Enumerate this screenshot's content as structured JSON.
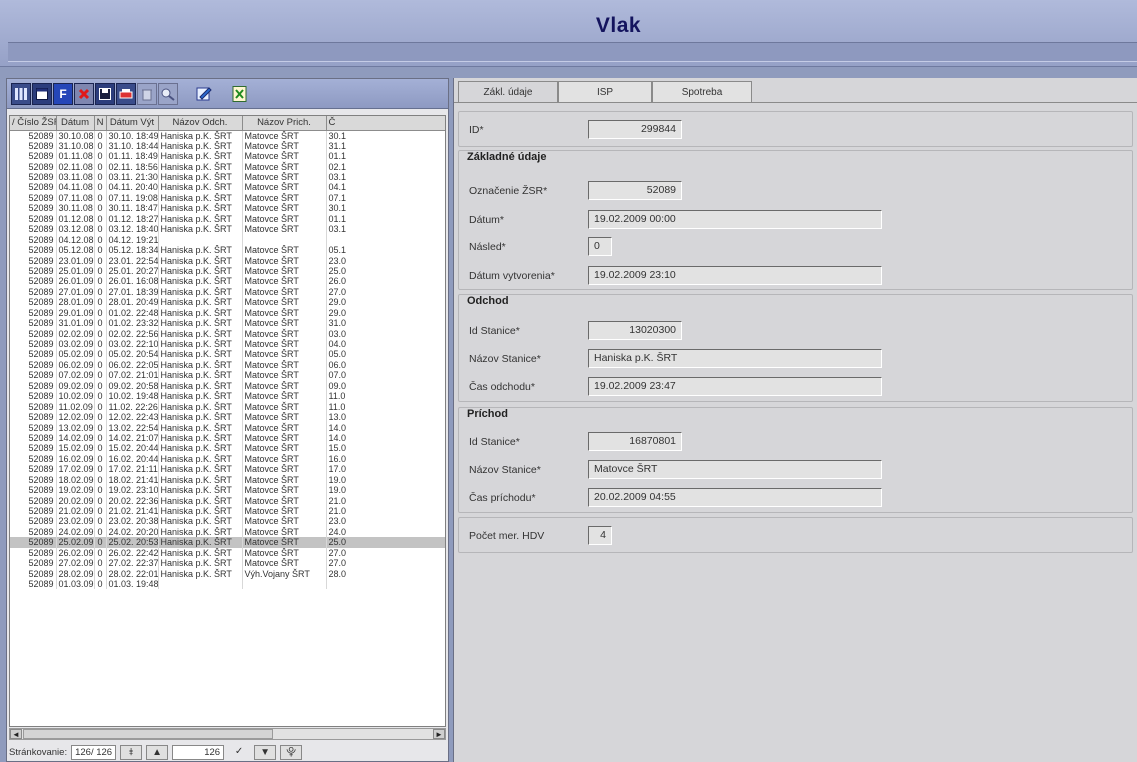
{
  "app": {
    "title": "Vlak"
  },
  "toolbar": {
    "buttons": [
      {
        "icon": "grid-columns-icon"
      },
      {
        "icon": "window-icon"
      },
      {
        "icon": "filter-icon",
        "label": "F"
      },
      {
        "icon": "delete-icon"
      },
      {
        "icon": "save-icon"
      },
      {
        "icon": "print-icon"
      },
      {
        "icon": "trash-icon"
      },
      {
        "icon": "zoom-icon"
      },
      {
        "icon": "edit-icon"
      },
      {
        "icon": "export-excel-icon"
      }
    ]
  },
  "grid": {
    "columns": [
      "/ Číslo ŽSR",
      "Dátum",
      "N",
      "Dátum Výt",
      "Názov Odch.",
      "Názov Prich.",
      "Č"
    ],
    "selected_index": 39,
    "rows": [
      [
        "52089",
        "30.10.08",
        "0",
        "30.10. 18:49",
        "Haniska p.K. ŠRT",
        "Matovce ŠRT",
        "30.1"
      ],
      [
        "52089",
        "31.10.08",
        "0",
        "31.10. 18:44",
        "Haniska p.K. ŠRT",
        "Matovce ŠRT",
        "31.1"
      ],
      [
        "52089",
        "01.11.08",
        "0",
        "01.11. 18:49",
        "Haniska p.K. ŠRT",
        "Matovce ŠRT",
        "01.1"
      ],
      [
        "52089",
        "02.11.08",
        "0",
        "02.11. 18:56",
        "Haniska p.K. ŠRT",
        "Matovce ŠRT",
        "02.1"
      ],
      [
        "52089",
        "03.11.08",
        "0",
        "03.11. 21:30",
        "Haniska p.K. ŠRT",
        "Matovce ŠRT",
        "03.1"
      ],
      [
        "52089",
        "04.11.08",
        "0",
        "04.11. 20:40",
        "Haniska p.K. ŠRT",
        "Matovce ŠRT",
        "04.1"
      ],
      [
        "52089",
        "07.11.08",
        "0",
        "07.11. 19:08",
        "Haniska p.K. ŠRT",
        "Matovce ŠRT",
        "07.1"
      ],
      [
        "52089",
        "30.11.08",
        "0",
        "30.11. 18:47",
        "Haniska p.K. ŠRT",
        "Matovce ŠRT",
        "30.1"
      ],
      [
        "52089",
        "01.12.08",
        "0",
        "01.12. 18:27",
        "Haniska p.K. ŠRT",
        "Matovce ŠRT",
        "01.1"
      ],
      [
        "52089",
        "03.12.08",
        "0",
        "03.12. 18:40",
        "Haniska p.K. ŠRT",
        "Matovce ŠRT",
        "03.1"
      ],
      [
        "52089",
        "04.12.08",
        "0",
        "04.12. 19:21",
        "",
        "",
        ""
      ],
      [
        "52089",
        "05.12.08",
        "0",
        "05.12. 18:34",
        "Haniska p.K. ŠRT",
        "Matovce ŠRT",
        "05.1"
      ],
      [
        "52089",
        "23.01.09",
        "0",
        "23.01. 22:54",
        "Haniska p.K. ŠRT",
        "Matovce ŠRT",
        "23.0"
      ],
      [
        "52089",
        "25.01.09",
        "0",
        "25.01. 20:27",
        "Haniska p.K. ŠRT",
        "Matovce ŠRT",
        "25.0"
      ],
      [
        "52089",
        "26.01.09",
        "0",
        "26.01. 16:08",
        "Haniska p.K. ŠRT",
        "Matovce ŠRT",
        "26.0"
      ],
      [
        "52089",
        "27.01.09",
        "0",
        "27.01. 18:39",
        "Haniska p.K. ŠRT",
        "Matovce ŠRT",
        "27.0"
      ],
      [
        "52089",
        "28.01.09",
        "0",
        "28.01. 20:49",
        "Haniska p.K. ŠRT",
        "Matovce ŠRT",
        "29.0"
      ],
      [
        "52089",
        "29.01.09",
        "0",
        "01.02. 22:48",
        "Haniska p.K. ŠRT",
        "Matovce ŠRT",
        "29.0"
      ],
      [
        "52089",
        "31.01.09",
        "0",
        "01.02. 23:32",
        "Haniska p.K. ŠRT",
        "Matovce ŠRT",
        "31.0"
      ],
      [
        "52089",
        "02.02.09",
        "0",
        "02.02. 22:56",
        "Haniska p.K. ŠRT",
        "Matovce ŠRT",
        "03.0"
      ],
      [
        "52089",
        "03.02.09",
        "0",
        "03.02. 22:10",
        "Haniska p.K. ŠRT",
        "Matovce ŠRT",
        "04.0"
      ],
      [
        "52089",
        "05.02.09",
        "0",
        "05.02. 20:54",
        "Haniska p.K. ŠRT",
        "Matovce ŠRT",
        "05.0"
      ],
      [
        "52089",
        "06.02.09",
        "0",
        "06.02. 22:05",
        "Haniska p.K. ŠRT",
        "Matovce ŠRT",
        "06.0"
      ],
      [
        "52089",
        "07.02.09",
        "0",
        "07.02. 21:01",
        "Haniska p.K. ŠRT",
        "Matovce ŠRT",
        "07.0"
      ],
      [
        "52089",
        "09.02.09",
        "0",
        "09.02. 20:58",
        "Haniska p.K. ŠRT",
        "Matovce ŠRT",
        "09.0"
      ],
      [
        "52089",
        "10.02.09",
        "0",
        "10.02. 19:48",
        "Haniska p.K. ŠRT",
        "Matovce ŠRT",
        "11.0"
      ],
      [
        "52089",
        "11.02.09",
        "0",
        "11.02. 22:26",
        "Haniska p.K. ŠRT",
        "Matovce ŠRT",
        "11.0"
      ],
      [
        "52089",
        "12.02.09",
        "0",
        "12.02. 22:43",
        "Haniska p.K. ŠRT",
        "Matovce ŠRT",
        "13.0"
      ],
      [
        "52089",
        "13.02.09",
        "0",
        "13.02. 22:54",
        "Haniska p.K. ŠRT",
        "Matovce ŠRT",
        "14.0"
      ],
      [
        "52089",
        "14.02.09",
        "0",
        "14.02. 21:07",
        "Haniska p.K. ŠRT",
        "Matovce ŠRT",
        "14.0"
      ],
      [
        "52089",
        "15.02.09",
        "0",
        "15.02. 20:44",
        "Haniska p.K. ŠRT",
        "Matovce ŠRT",
        "15.0"
      ],
      [
        "52089",
        "16.02.09",
        "0",
        "16.02. 20:44",
        "Haniska p.K. ŠRT",
        "Matovce ŠRT",
        "16.0"
      ],
      [
        "52089",
        "17.02.09",
        "0",
        "17.02. 21:11",
        "Haniska p.K. ŠRT",
        "Matovce ŠRT",
        "17.0"
      ],
      [
        "52089",
        "18.02.09",
        "0",
        "18.02. 21:41",
        "Haniska p.K. ŠRT",
        "Matovce ŠRT",
        "19.0"
      ],
      [
        "52089",
        "19.02.09",
        "0",
        "19.02. 23:10",
        "Haniska p.K. ŠRT",
        "Matovce ŠRT",
        "19.0"
      ],
      [
        "52089",
        "20.02.09",
        "0",
        "20.02. 22:36",
        "Haniska p.K. ŠRT",
        "Matovce ŠRT",
        "21.0"
      ],
      [
        "52089",
        "21.02.09",
        "0",
        "21.02. 21:41",
        "Haniska p.K. ŠRT",
        "Matovce ŠRT",
        "21.0"
      ],
      [
        "52089",
        "23.02.09",
        "0",
        "23.02. 20:38",
        "Haniska p.K. ŠRT",
        "Matovce ŠRT",
        "23.0"
      ],
      [
        "52089",
        "24.02.09",
        "0",
        "24.02. 20:20",
        "Haniska p.K. ŠRT",
        "Matovce ŠRT",
        "24.0"
      ],
      [
        "52089",
        "25.02.09",
        "0",
        "25.02. 20:53",
        "Haniska p.K. ŠRT",
        "Matovce ŠRT",
        "25.0"
      ],
      [
        "52089",
        "26.02.09",
        "0",
        "26.02. 22:42",
        "Haniska p.K. ŠRT",
        "Matovce ŠRT",
        "27.0"
      ],
      [
        "52089",
        "27.02.09",
        "0",
        "27.02. 22:37",
        "Haniska p.K. ŠRT",
        "Matovce ŠRT",
        "27.0"
      ],
      [
        "52089",
        "28.02.09",
        "0",
        "28.02. 22:01",
        "Haniska p.K. ŠRT",
        "Výh.Vojany ŠRT",
        "28.0"
      ],
      [
        "52089",
        "01.03.09",
        "0",
        "01.03. 19:48",
        "",
        "",
        ""
      ]
    ]
  },
  "pager": {
    "label": "Stránkovanie:",
    "page_info": "126/ 126",
    "current": "126",
    "first_icon": "first-page-icon",
    "prev_icon": "previous-icon",
    "confirm_icon": "check-icon",
    "next_icon": "next-icon",
    "last_icon": "last-page-icon"
  },
  "tabs": [
    "Zákl. údaje",
    "ISP",
    "Spotreba"
  ],
  "detail": {
    "id_label": "ID*",
    "id_value": "299844",
    "zakladne": {
      "title": "Základné údaje",
      "oznacenie_label": "Označenie ŽSR*",
      "oznacenie_value": "52089",
      "datum_label": "Dátum*",
      "datum_value": "19.02.2009 00:00",
      "nasled_label": "Násled*",
      "nasled_value": "0",
      "vytvorenia_label": "Dátum vytvorenia*",
      "vytvorenia_value": "19.02.2009 23:10"
    },
    "odchod": {
      "title": "Odchod",
      "id_label": "Id Stanice*",
      "id_value": "13020300",
      "nazov_label": "Názov Stanice*",
      "nazov_value": "Haniska p.K. ŠRT",
      "cas_label": "Čas odchodu*",
      "cas_value": "19.02.2009 23:47"
    },
    "prichod": {
      "title": "Príchod",
      "id_label": "Id Stanice*",
      "id_value": "16870801",
      "nazov_label": "Názov Stanice*",
      "nazov_value": "Matovce ŠRT",
      "cas_label": "Čas príchodu*",
      "cas_value": "20.02.2009 04:55"
    },
    "pocet_label": "Počet mer. HDV",
    "pocet_value": "4"
  }
}
